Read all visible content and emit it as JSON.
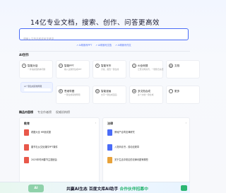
{
  "hero": {
    "title": "14亿专业文档，搜索、创作、问答更高效"
  },
  "search": {
    "placeholder": "请输入文档名称或者关键词"
  },
  "chips": [
    {
      "label": "AI帮我写PPT"
    },
    {
      "label": "AI帮我写文档"
    },
    {
      "label": "AI帮我写作文"
    }
  ],
  "ai_create": {
    "title": "AI创作",
    "cards": [
      {
        "title": "智能对话",
        "desc": "一步先搞懂各种问题",
        "icon": "chat-icon"
      },
      {
        "title": "智能PPT",
        "desc": "输入主题秒生成PPT",
        "icon": "ppt-icon"
      },
      {
        "title": "智能写作",
        "desc": "方案、报告一键生成",
        "icon": "pen-icon"
      },
      {
        "title": "AI全网搜",
        "desc": "汇聚全网资讯，一键整合总结",
        "icon": "globe-icon"
      },
      {
        "title": "文档",
        "desc": "",
        "icon": "doc-icon"
      },
      {
        "title": "思维导图",
        "desc": "一键生成思维导图",
        "icon": "mindmap-icon"
      },
      {
        "title": "智能漫画",
        "desc": "文字一键生成漫画",
        "icon": "comic-icon"
      },
      {
        "title": "多文档合成",
        "desc": "多个文档一键合成",
        "icon": "merge-icon"
      },
      {
        "title": "更多",
        "desc": "",
        "icon": "more-icon"
      }
    ],
    "banner_text": "AI一键生成思维导图"
  },
  "tabs": [
    {
      "label": "精品内容榜",
      "active": true
    },
    {
      "label": "专业作者榜",
      "active": false
    },
    {
      "label": "权威机构榜",
      "active": false
    }
  ],
  "panels": {
    "left": {
      "title": "教育",
      "more": "›",
      "docs": [
        {
          "name": "看图大全 HR面试题",
          "meta": "",
          "color": "#e8584a"
        },
        {
          "name": "春节礼仪文化课件PPT课件",
          "meta": "",
          "color": "#e8584a"
        },
        {
          "name": "2025年时间春节主题班会",
          "meta": "",
          "color": "#e8584a"
        }
      ]
    },
    "right": {
      "title": "法律",
      "more": "›",
      "docs": [
        {
          "name": "房地产合同法律研究",
          "meta": "",
          "color": "#4a6cf7"
        },
        {
          "name": "入党申请书 - 劳动法规章",
          "meta": "",
          "color": "#4a6cf7"
        },
        {
          "name": "关于生活中常见的法律问题有哪些",
          "meta": "",
          "color": "#e8a23a"
        }
      ]
    }
  },
  "footer": {
    "logo_text": "",
    "text_prefix": "共赢AI生态 ",
    "text_highlight": "百度文库AI助手",
    "text_suffix": " 合作伙伴招募中"
  },
  "colors": {
    "accent": "#4a6cf7",
    "green": "#2bb673"
  }
}
